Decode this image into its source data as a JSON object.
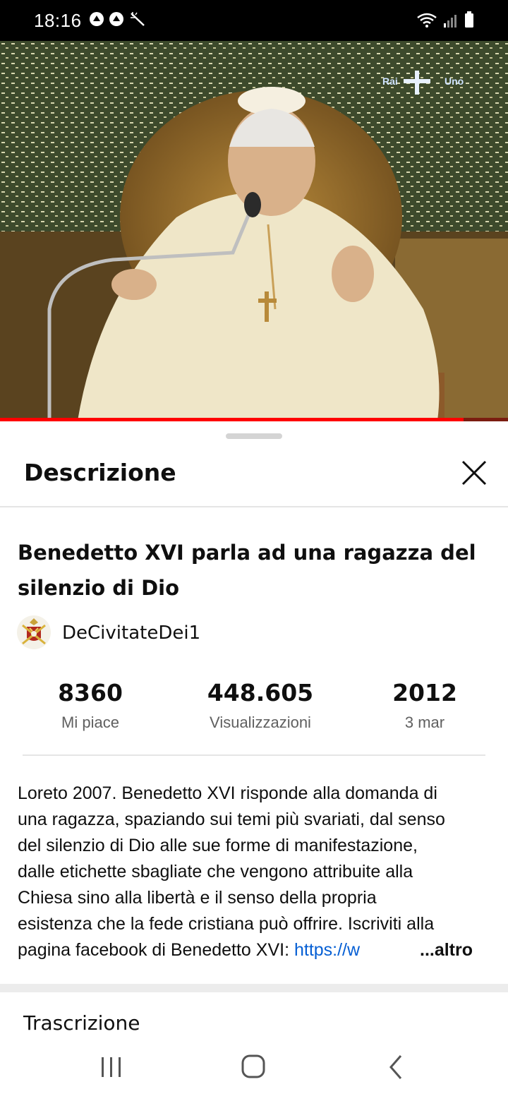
{
  "status_bar": {
    "time": "18:16"
  },
  "video": {
    "watermark_text": "Rai Uno",
    "progress_fraction": 0.913
  },
  "sheet": {
    "title": "Descrizione",
    "close_icon": "close-icon"
  },
  "video_info": {
    "title": "Benedetto XVI parla ad una ragazza del silenzio di Dio",
    "channel_name": "DeCivitateDei1"
  },
  "stats": {
    "likes_value": "8360",
    "likes_label": "Mi piace",
    "views_value": "448.605",
    "views_label": "Visualizzazioni",
    "year_value": "2012",
    "date_label": "3 mar"
  },
  "description": {
    "lines": [
      "Loreto 2007. Benedetto XVI risponde alla domanda di",
      "una ragazza, spaziando sui temi più svariati, dal senso",
      "del silenzio di Dio alle sue forme di manifestazione,",
      "dalle etichette sbagliate che vengono attribuite alla",
      "Chiesa sino alla libertà e il senso della propria",
      "esistenza che la fede cristiana può offrire. Iscriviti alla"
    ],
    "last_line_text": "pagina facebook di Benedetto XVI: ",
    "link_text": "https://w",
    "more_label": "...altro"
  },
  "transcript": {
    "label": "Trascrizione"
  },
  "colors": {
    "link": "#065fd4",
    "progress": "#ff0000",
    "secondary_text": "#606060"
  }
}
